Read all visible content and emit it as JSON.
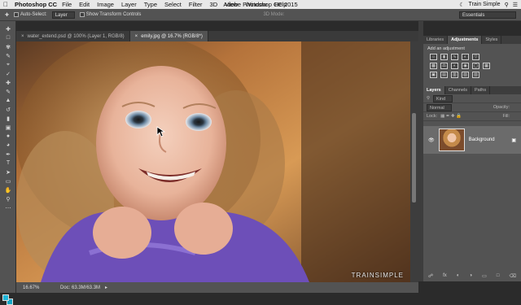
{
  "menubar": {
    "app": "Photoshop CC",
    "menus": [
      "File",
      "Edit",
      "Image",
      "Layer",
      "Type",
      "Select",
      "Filter",
      "3D",
      "View",
      "Window",
      "Help"
    ],
    "title": "Adobe Photoshop CC 2015",
    "right_text": "Train Simple"
  },
  "options": {
    "auto_select": "Auto-Select:",
    "layer_select": "Layer",
    "show_transform": "Show Transform Controls",
    "mode_3d": "3D Mode:",
    "workspace": "Essentials"
  },
  "doc_tabs": [
    {
      "label": "water_extend.psd @ 100% (Layer 1, RGB/8)"
    },
    {
      "label": "emily.jpg @ 16.7% (RGB/8*)"
    }
  ],
  "status": {
    "zoom": "16.67%",
    "doc": "Doc: 63.3M/63.3M"
  },
  "adjust_panel": {
    "tabs": [
      "Libraries",
      "Adjustments",
      "Styles"
    ],
    "add_label": "Add an adjustment"
  },
  "layers_panel": {
    "tabs": [
      "Layers",
      "Channels",
      "Paths"
    ],
    "kind": "Kind",
    "blend": "Normal",
    "opacity_label": "Opacity:",
    "lock_label": "Lock:",
    "fill_label": "Fill:",
    "layer_name": "Background"
  },
  "brand": "TRAINSIMPLE",
  "colors": {
    "foreground": "#1fb6d9",
    "background": "#14a7c9"
  }
}
